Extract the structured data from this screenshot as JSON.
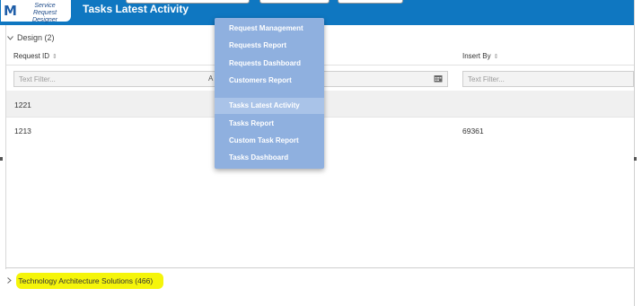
{
  "header": {
    "logo_line1": "Service Request",
    "logo_line2": "Designer",
    "title": "Tasks Latest Activity"
  },
  "grid": {
    "group_label": "Design (2)",
    "columns": [
      {
        "label": "Request ID"
      },
      {
        "label": "Insert By"
      }
    ],
    "filter_placeholder": "Text Filter...",
    "filter_partial_text": "A",
    "rows": [
      {
        "request_id": "1221",
        "insert_by": ""
      },
      {
        "request_id": "1213",
        "insert_by": "69361"
      }
    ],
    "collapsed_group": "Technology Architecture Solutions (466)"
  },
  "menu": {
    "items": [
      "Request Management",
      "Requests Report",
      "Requests Dashboard",
      "Customers Report",
      "Tasks Latest Activity",
      "Tasks Report",
      "Custom Task Report",
      "Tasks Dashboard"
    ],
    "active_item": "Tasks Latest Activity"
  },
  "colors": {
    "topbar": "#0f77c1",
    "menu_bg": "#8fb0df",
    "highlight": "#f5f50a"
  }
}
